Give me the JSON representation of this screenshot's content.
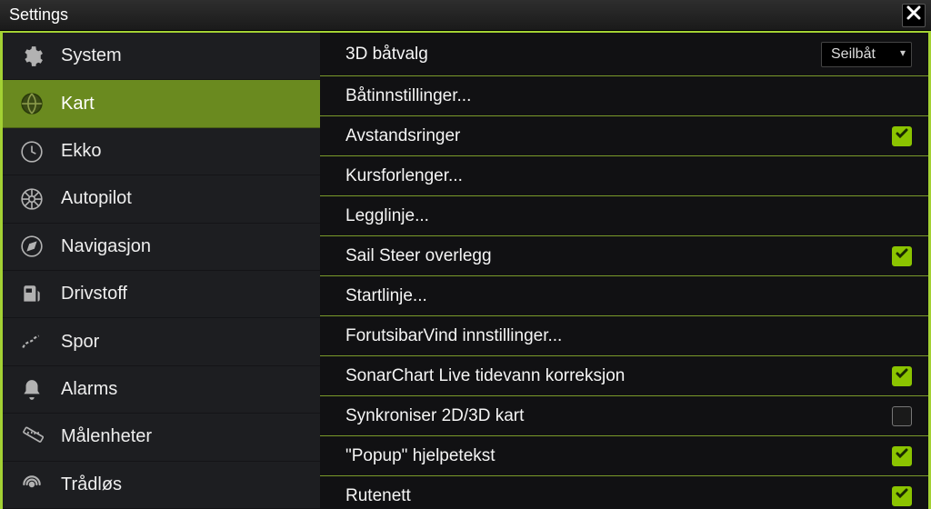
{
  "window": {
    "title": "Settings"
  },
  "sidebar": {
    "items": [
      {
        "label": "System"
      },
      {
        "label": "Kart"
      },
      {
        "label": "Ekko"
      },
      {
        "label": "Autopilot"
      },
      {
        "label": "Navigasjon"
      },
      {
        "label": "Drivstoff"
      },
      {
        "label": "Spor"
      },
      {
        "label": "Alarms"
      },
      {
        "label": "Målenheter"
      },
      {
        "label": "Trådløs"
      }
    ]
  },
  "settings": {
    "items": [
      {
        "label": "3D båtvalg",
        "type": "select",
        "value": "Seilbåt"
      },
      {
        "label": "Båtinnstillinger...",
        "type": "link"
      },
      {
        "label": "Avstandsringer",
        "type": "checkbox",
        "checked": true
      },
      {
        "label": "Kursforlenger...",
        "type": "link"
      },
      {
        "label": "Legglinje...",
        "type": "link"
      },
      {
        "label": "Sail Steer overlegg",
        "type": "checkbox",
        "checked": true
      },
      {
        "label": "Startlinje...",
        "type": "link"
      },
      {
        "label": "ForutsibarVind innstillinger...",
        "type": "link"
      },
      {
        "label": "SonarChart Live tidevann korreksjon",
        "type": "checkbox",
        "checked": true
      },
      {
        "label": "Synkroniser 2D/3D kart",
        "type": "checkbox",
        "checked": false
      },
      {
        "label": "\"Popup\" hjelpetekst",
        "type": "checkbox",
        "checked": true
      },
      {
        "label": "Rutenett",
        "type": "checkbox",
        "checked": true
      }
    ]
  }
}
